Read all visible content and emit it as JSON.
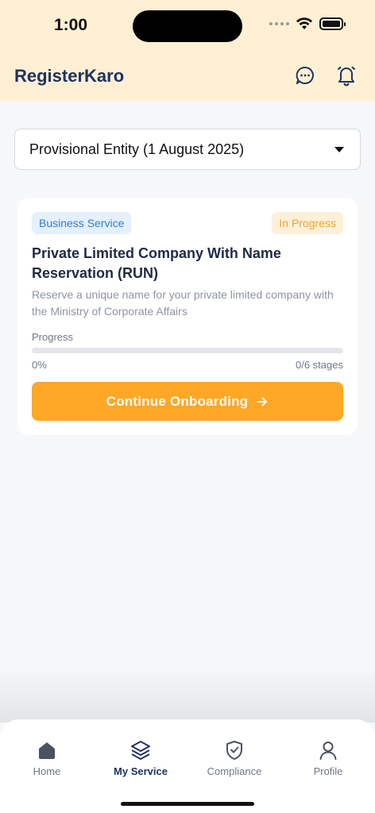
{
  "status_bar": {
    "time": "1:00"
  },
  "header": {
    "title": "RegisterKaro",
    "chat_icon": "chat-bubble-icon",
    "bell_icon": "bell-icon",
    "background": "#fff0d4"
  },
  "entity_selector": {
    "value": "Provisional Entity (1 August 2025)"
  },
  "service_card": {
    "category_badge": "Business Service",
    "status_badge": "In Progress",
    "title": "Private Limited Company With Name Reservation (RUN)",
    "description": "Reserve a unique name for your private limited company with the Ministry of Corporate Affairs",
    "progress_label": "Progress",
    "progress_percent_text": "0%",
    "progress_value": 0,
    "stages_text": "0/6 stages",
    "cta_label": "Continue Onboarding",
    "cta_icon": "arrow-right-icon"
  },
  "tabbar": {
    "tabs": [
      {
        "label": "Home",
        "icon": "home-icon",
        "active": false
      },
      {
        "label": "My Service",
        "icon": "layers-icon",
        "active": true
      },
      {
        "label": "Compliance",
        "icon": "shield-check-icon",
        "active": false
      },
      {
        "label": "Profile",
        "icon": "person-icon",
        "active": false
      }
    ]
  },
  "colors": {
    "accent": "#ffa726",
    "brand_text": "#1f3260",
    "service_badge": "#2f7fd2",
    "status_badge": "#f0a42a"
  }
}
